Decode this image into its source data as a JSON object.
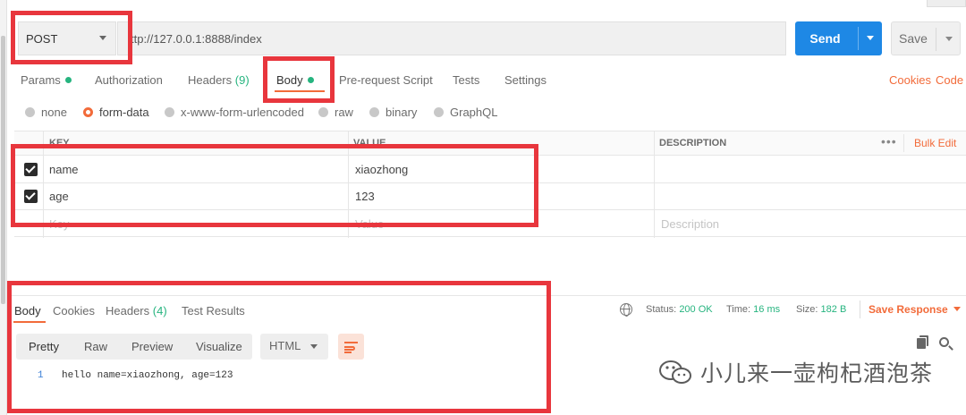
{
  "request": {
    "method": "POST",
    "url": "ttp://127.0.0.1:8888/index",
    "send_label": "Send",
    "save_label": "Save"
  },
  "request_tabs": [
    {
      "label": "Params",
      "dot": true
    },
    {
      "label": "Authorization"
    },
    {
      "label": "Headers",
      "count": "(9)"
    },
    {
      "label": "Body",
      "dot": true,
      "active": true
    },
    {
      "label": "Pre-request Script"
    },
    {
      "label": "Tests"
    },
    {
      "label": "Settings"
    }
  ],
  "links": {
    "cookies": "Cookies",
    "code": "Code"
  },
  "body_types": [
    {
      "label": "none"
    },
    {
      "label": "form-data",
      "selected": true
    },
    {
      "label": "x-www-form-urlencoded"
    },
    {
      "label": "raw"
    },
    {
      "label": "binary"
    },
    {
      "label": "GraphQL"
    }
  ],
  "params_table": {
    "headers": {
      "key": "KEY",
      "value": "VALUE",
      "description": "DESCRIPTION"
    },
    "bulk_edit": "Bulk Edit",
    "more": "•••",
    "rows": [
      {
        "checked": true,
        "key": "name",
        "value": "xiaozhong",
        "description": ""
      },
      {
        "checked": true,
        "key": "age",
        "value": "123",
        "description": ""
      }
    ],
    "placeholder_row": {
      "key": "Key",
      "value": "Value",
      "description": "Description"
    }
  },
  "response": {
    "tabs": [
      {
        "label": "Body",
        "active": true
      },
      {
        "label": "Cookies"
      },
      {
        "label": "Headers",
        "count": "(4)"
      },
      {
        "label": "Test Results"
      }
    ],
    "status_label": "Status:",
    "status_value": "200 OK",
    "time_label": "Time:",
    "time_value": "16 ms",
    "size_label": "Size:",
    "size_value": "182 B",
    "save_response": "Save Response",
    "view_modes": [
      "Pretty",
      "Raw",
      "Preview",
      "Visualize"
    ],
    "format": "HTML",
    "line_number": "1",
    "content": "hello name=xiaozhong, age=123"
  },
  "watermark": {
    "text": "小儿来一壶枸杞酒泡茶"
  },
  "colors": {
    "accent": "#f26b3a",
    "primary": "#1e88e5",
    "success": "#26b47f",
    "annotation": "#e8363d"
  }
}
